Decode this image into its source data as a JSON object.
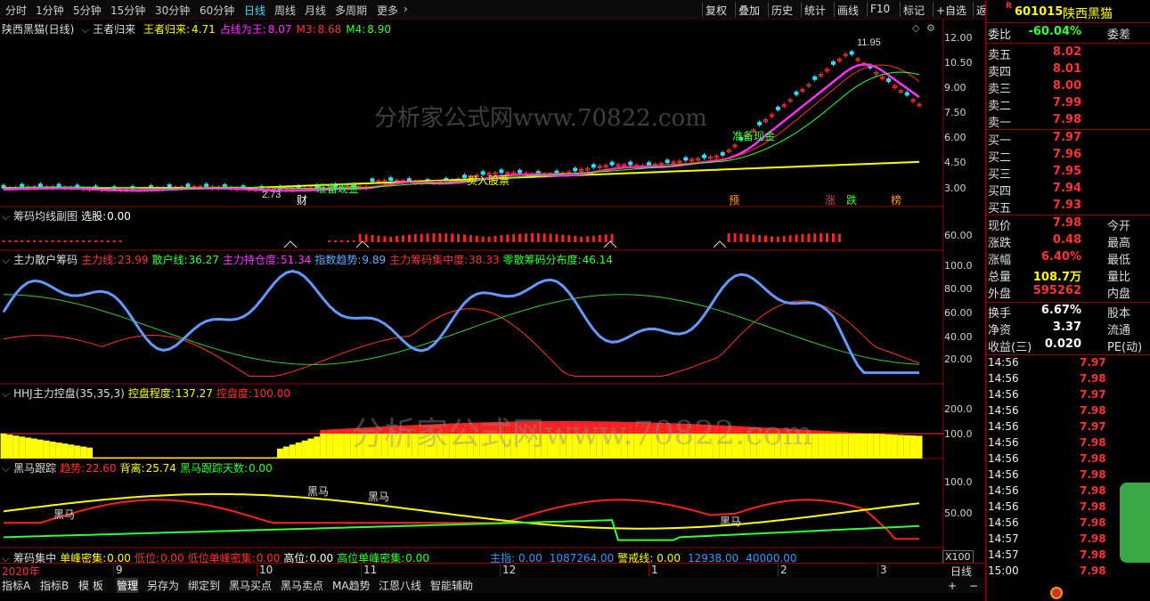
{
  "toolbar": {
    "periods": [
      "分时",
      "1分钟",
      "5分钟",
      "15分钟",
      "30分钟",
      "60分钟",
      "日线",
      "周线",
      "月线",
      "多周期",
      "更多"
    ],
    "active": "日线",
    "right_buttons": [
      "复权",
      "叠加",
      "历史",
      "统计",
      "画线",
      "F10",
      "标记",
      "+自选",
      "返回"
    ]
  },
  "stock": {
    "code": "601015",
    "name": "陕西黑猫",
    "r_badge": "R"
  },
  "panel1": {
    "title": "陕西黑猫(日线)",
    "indicator": "王者归来",
    "items": [
      {
        "label": "王者归来:",
        "value": "4.71",
        "color": "#ffff00"
      },
      {
        "label": "占线为王:",
        "value": "8.07",
        "color": "#ff33ff"
      },
      {
        "label": "M3:",
        "value": "8.68",
        "color": "#ff3333"
      },
      {
        "label": "M4:",
        "value": "8.90",
        "color": "#33ff33"
      }
    ],
    "yaxis": [
      "12.00",
      "10.50",
      "9.00",
      "7.50",
      "6.00",
      "4.50",
      "3.00"
    ],
    "high_label": "11.95",
    "low_label": "2.73",
    "annotations": [
      "准备现金",
      "准备现金",
      "买入股票"
    ],
    "markers": [
      "财",
      "预",
      "涨",
      "跌",
      "榜"
    ]
  },
  "panel2": {
    "title": "筹码均线副图",
    "items": [
      {
        "label": "选股:",
        "value": "0.00",
        "color": "#ffffff"
      }
    ],
    "yaxis": [
      "60.00"
    ]
  },
  "panel3": {
    "title": "主力散户筹码",
    "items": [
      {
        "label": "主力线:",
        "value": "23.99",
        "color": "#ff3333"
      },
      {
        "label": "散户线:",
        "value": "36.27",
        "color": "#33ff33"
      },
      {
        "label": "主力持仓度:",
        "value": "51.34",
        "color": "#ff33ff"
      },
      {
        "label": "指数趋势:",
        "value": "9.89",
        "color": "#66aaff"
      },
      {
        "label": "主力筹码集中度:",
        "value": "38.33",
        "color": "#ff3333"
      },
      {
        "label": "零散筹码分布度:",
        "value": "46.14",
        "color": "#33ff33"
      }
    ],
    "yaxis": [
      "100.0",
      "80.00",
      "60.00",
      "40.00",
      "20.00"
    ]
  },
  "panel4": {
    "title": "HHJ主力控盘(35,35,3)",
    "items": [
      {
        "label": "控盘程度:",
        "value": "137.27",
        "color": "#ffff00"
      },
      {
        "label": "控盘度:",
        "value": "100.00",
        "color": "#ff3333"
      }
    ],
    "yaxis": [
      "200.0",
      "100.0"
    ]
  },
  "panel5": {
    "title": "黑马跟踪",
    "items": [
      {
        "label": "趋势:",
        "value": "22.60",
        "color": "#ff3333"
      },
      {
        "label": "背离:",
        "value": "25.74",
        "color": "#ffff00"
      },
      {
        "label": "黑马跟踪天数:",
        "value": "0.00",
        "color": "#33ff33"
      }
    ],
    "yaxis": [
      "100.0",
      "50.00"
    ],
    "labels": [
      "黑马",
      "黑马",
      "黑马",
      "黑马"
    ]
  },
  "panel6": {
    "title": "筹码集中",
    "items": [
      {
        "label": "单峰密集:",
        "value": "0.00",
        "color": "#ffff00"
      },
      {
        "label": "低位:",
        "value": "0.00",
        "color": "#ff3333"
      },
      {
        "label": "低位单峰密集:",
        "value": "0.00",
        "color": "#ff3333"
      },
      {
        "label": "高位:",
        "value": "0.00",
        "color": "#ffffff"
      },
      {
        "label": "高位单峰密集:",
        "value": "0.00",
        "color": "#33ff33"
      }
    ],
    "extra": [
      {
        "label": "主指:",
        "value": "0.00",
        "color": "#3399ff"
      },
      {
        "label": "",
        "value": "1087264.00",
        "color": "#3399ff"
      },
      {
        "label": "警戒线:",
        "value": "0.00",
        "color": "#ffff00"
      },
      {
        "label": "",
        "value": "12938.00",
        "color": "#3399ff"
      },
      {
        "label": "",
        "value": "40000.00",
        "color": "#3399ff"
      }
    ],
    "zoom": "X100"
  },
  "timeaxis": {
    "year": "2020年",
    "months": [
      "9",
      "10",
      "11",
      "12",
      "1",
      "2",
      "3"
    ],
    "period": "日线"
  },
  "bottombar": [
    "指标A",
    "指标B",
    "模 板",
    "管理",
    "另存为",
    "绑定到",
    "黑马买点",
    "黑马卖点",
    "MA趋势",
    "江恩八线",
    "智能辅助"
  ],
  "bottombar_active": "管理",
  "quote": {
    "webi_label": "委比",
    "webi": "-60.04%",
    "wecha_label": "委差",
    "sells": [
      {
        "label": "卖五",
        "price": "8.02"
      },
      {
        "label": "卖四",
        "price": "8.01"
      },
      {
        "label": "卖三",
        "price": "8.00"
      },
      {
        "label": "卖二",
        "price": "7.99"
      },
      {
        "label": "卖一",
        "price": "7.98"
      }
    ],
    "buys": [
      {
        "label": "买一",
        "price": "7.97"
      },
      {
        "label": "买二",
        "price": "7.96"
      },
      {
        "label": "买三",
        "price": "7.95"
      },
      {
        "label": "买四",
        "price": "7.94"
      },
      {
        "label": "买五",
        "price": "7.93"
      }
    ],
    "stats": [
      {
        "l": "现价",
        "v": "7.98",
        "r": "今开",
        "c": "#ff3333"
      },
      {
        "l": "涨跌",
        "v": "0.48",
        "r": "最高",
        "c": "#ff3333"
      },
      {
        "l": "涨幅",
        "v": "6.40%",
        "r": "最低",
        "c": "#ff3333"
      },
      {
        "l": "总量",
        "v": "108.7万",
        "r": "量比",
        "c": "#ffff00"
      },
      {
        "l": "外盘",
        "v": "595262",
        "r": "内盘",
        "c": "#ff3333"
      },
      {
        "l": "换手",
        "v": "6.67%",
        "r": "股本",
        "c": "#ffffff"
      },
      {
        "l": "净资",
        "v": "3.37",
        "r": "流通",
        "c": "#ffffff"
      },
      {
        "l": "收益(三)",
        "v": "0.020",
        "r": "PE(动)",
        "c": "#ffffff"
      }
    ],
    "ticks": [
      {
        "t": "14:56",
        "p": "7.97"
      },
      {
        "t": "14:56",
        "p": "7.98"
      },
      {
        "t": "14:56",
        "p": "7.97"
      },
      {
        "t": "14:56",
        "p": "7.98"
      },
      {
        "t": "14:56",
        "p": "7.97"
      },
      {
        "t": "14:56",
        "p": "7.98"
      },
      {
        "t": "14:56",
        "p": "7.98"
      },
      {
        "t": "14:56",
        "p": "7.98"
      },
      {
        "t": "14:56",
        "p": "7.98"
      },
      {
        "t": "14:56",
        "p": "7.98"
      },
      {
        "t": "14:56",
        "p": "7.98"
      },
      {
        "t": "14:57",
        "p": "7.98"
      },
      {
        "t": "14:57",
        "p": "7.98"
      },
      {
        "t": "15:00",
        "p": "7.98"
      }
    ]
  },
  "watermark": "分析家公式网www.70822.com",
  "bottom_controls": [
    "+",
    "−"
  ]
}
